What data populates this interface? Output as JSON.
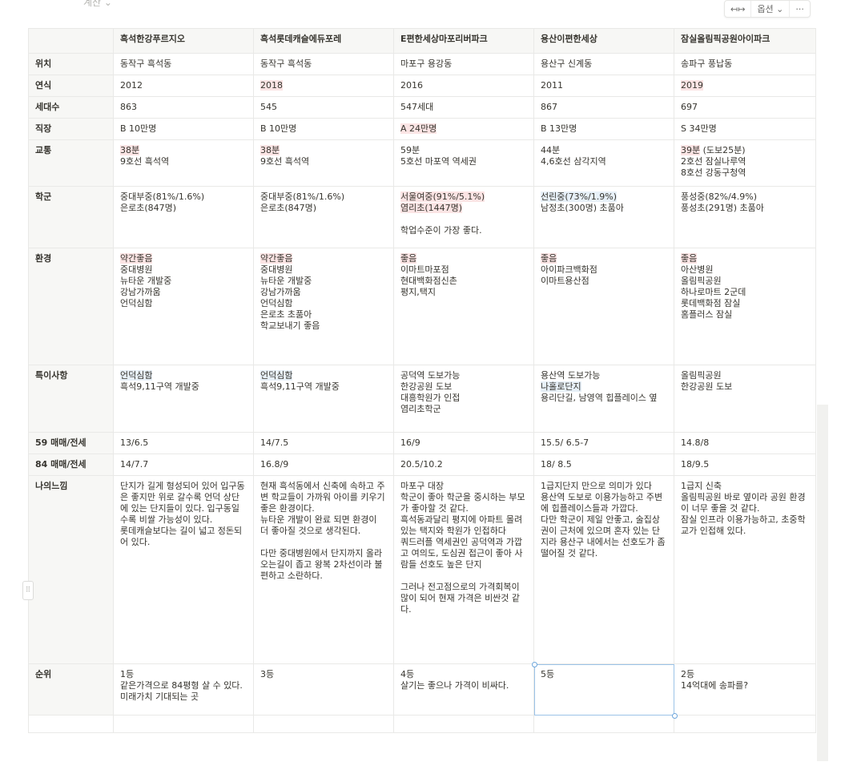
{
  "view_label": "계산 ⌄",
  "toolbar": {
    "resize": "↤↦",
    "options": "옵션 ⌄",
    "more": "···"
  },
  "columns": [
    "흑석한강푸르지오",
    "흑석롯데캐슬에듀포레",
    "E편한세상마포리버파크",
    "용산이편한세상",
    "잠실올림픽공원아이파크"
  ],
  "rows": [
    {
      "label": "위치",
      "cells": [
        [
          {
            "t": "동작구 흑석동"
          }
        ],
        [
          {
            "t": "동작구 흑석동"
          }
        ],
        [
          {
            "t": "마포구 용강동"
          }
        ],
        [
          {
            "t": "용산구 신계동"
          }
        ],
        [
          {
            "t": "송파구 풍납동"
          }
        ]
      ]
    },
    {
      "label": "연식",
      "cells": [
        [
          {
            "t": "2012"
          }
        ],
        [
          {
            "t": "2018",
            "h": "red"
          }
        ],
        [
          {
            "t": "2016"
          }
        ],
        [
          {
            "t": "2011"
          }
        ],
        [
          {
            "t": "2019",
            "h": "red"
          }
        ]
      ]
    },
    {
      "label": "세대수",
      "cells": [
        [
          {
            "t": "863"
          }
        ],
        [
          {
            "t": "545"
          }
        ],
        [
          {
            "t": "547세대"
          }
        ],
        [
          {
            "t": "867"
          }
        ],
        [
          {
            "t": "697"
          }
        ]
      ]
    },
    {
      "label": "직장",
      "cells": [
        [
          {
            "t": "B 10만명"
          }
        ],
        [
          {
            "t": "B 10만명"
          }
        ],
        [
          {
            "t": "A 24만명",
            "h": "red"
          }
        ],
        [
          {
            "t": "B 13만명"
          }
        ],
        [
          {
            "t": "S 34만명"
          }
        ]
      ]
    },
    {
      "label": "교통",
      "cells": [
        [
          {
            "t": "38분",
            "h": "red"
          },
          {
            "t": "9호선 흑석역"
          }
        ],
        [
          {
            "t": "38분",
            "h": "red"
          },
          {
            "t": "9호선 흑석역"
          }
        ],
        [
          {
            "t": "59분"
          },
          {
            "t": "5호선 마포역 역세권"
          }
        ],
        [
          {
            "t": "44분"
          },
          {
            "t": "4,6호선 삼각지역"
          }
        ],
        [
          {
            "t": "39분",
            "h": "red",
            "s": " (도보25분)"
          },
          {
            "t": "2호선 잠실나루역"
          },
          {
            "t": "8호선 강동구청역"
          }
        ]
      ]
    },
    {
      "label": "학군",
      "cells": [
        [
          {
            "t": "중대부중(81%/1.6%)"
          },
          {
            "t": "은로초(847명)"
          }
        ],
        [
          {
            "t": "중대부중(81%/1.6%)"
          },
          {
            "t": "은로초(847명)"
          }
        ],
        [
          {
            "t": "서울여중(91%/5.1%)",
            "h": "red"
          },
          {
            "t": "염리초(1447명)",
            "h": "red"
          },
          {
            "t": " "
          },
          {
            "t": "학업수준이 가장 좋다."
          }
        ],
        [
          {
            "t": "선린중(73%/1.9%)",
            "h": "blue"
          },
          {
            "t": "남정초(300명) 초품아"
          }
        ],
        [
          {
            "t": "풍성중(82%/4.9%)"
          },
          {
            "t": "풍성초(291명) 초품아"
          }
        ]
      ]
    },
    {
      "label": "환경",
      "cells": [
        [
          {
            "t": "약간좋음",
            "h": "red"
          },
          {
            "t": "중대병원"
          },
          {
            "t": "뉴타운 개발중"
          },
          {
            "t": "강남가까움"
          },
          {
            "t": "언덕심함"
          }
        ],
        [
          {
            "t": "약간좋음",
            "h": "red"
          },
          {
            "t": "중대병원"
          },
          {
            "t": "뉴타운 개발중"
          },
          {
            "t": "강남가까움"
          },
          {
            "t": "언덕심함"
          },
          {
            "t": "은로초 초품아"
          },
          {
            "t": "학교보내기 좋음"
          }
        ],
        [
          {
            "t": "좋음",
            "h": "red"
          },
          {
            "t": "이마트마포점"
          },
          {
            "t": "현대백화점신촌"
          },
          {
            "t": "평지,택지"
          }
        ],
        [
          {
            "t": "좋음",
            "h": "red"
          },
          {
            "t": "아이파크백화점"
          },
          {
            "t": "이마트용산점"
          }
        ],
        [
          {
            "t": "좋음",
            "h": "red"
          },
          {
            "t": "아산병원"
          },
          {
            "t": "올림픽공원"
          },
          {
            "t": "하나로마트 2군데"
          },
          {
            "t": "롯데백화점 잠실"
          },
          {
            "t": "홈플러스 잠실"
          }
        ]
      ]
    },
    {
      "label": "특이사항",
      "cells": [
        [
          {
            "t": "언덕심함",
            "h": "blue"
          },
          {
            "t": "흑석9,11구역 개발중"
          }
        ],
        [
          {
            "t": "언덕심함",
            "h": "blue"
          },
          {
            "t": "흑석9,11구역 개발중"
          }
        ],
        [
          {
            "t": "공덕역 도보가능"
          },
          {
            "t": "한강공원 도보"
          },
          {
            "t": "대흥학원가 인접"
          },
          {
            "t": "염리초학군"
          }
        ],
        [
          {
            "t": "용산역 도보가능"
          },
          {
            "t": "나홀로단지",
            "h": "blue"
          },
          {
            "t": "용리단길, 남영역 힙플레이스 옆"
          }
        ],
        [
          {
            "t": "올림픽공원"
          },
          {
            "t": "한강공원 도보"
          }
        ]
      ]
    },
    {
      "label": "59 매매/전세",
      "cells": [
        [
          {
            "t": "13/6.5"
          }
        ],
        [
          {
            "t": "14/7.5"
          }
        ],
        [
          {
            "t": "16/9"
          }
        ],
        [
          {
            "t": "15.5/ 6.5-7"
          }
        ],
        [
          {
            "t": "14.8/8"
          }
        ]
      ]
    },
    {
      "label": "84 매매/전세",
      "cells": [
        [
          {
            "t": "14/7.7"
          }
        ],
        [
          {
            "t": "16.8/9"
          }
        ],
        [
          {
            "t": "20.5/10.2"
          }
        ],
        [
          {
            "t": "18/ 8.5"
          }
        ],
        [
          {
            "t": "18/9.5"
          }
        ]
      ]
    },
    {
      "label": "나의느낌",
      "cells": [
        [
          {
            "t": "단지가 길게 형성되어 있어 입구동은 좋지만 위로 갈수록 언덕 상단에 있는 단지들이 있다. 입구동일 수록 비쌀 가능성이 있다."
          },
          {
            "t": "롯데캐슬보다는 길이 넓고 정돈되어 있다."
          }
        ],
        [
          {
            "t": "현재 흑석동에서 신축에 속하고 주변 학교들이 가까워 아이를 키우기 좋은 환경이다."
          },
          {
            "t": "뉴타운 개발이 완료 되면 환경이 더 좋아질 것으로 생각된다."
          },
          {
            "t": " "
          },
          {
            "t": "다만 중대병원에서 단지까지 올라오는길이 좁고 왕복 2차선이라 불편하고 소란하다."
          }
        ],
        [
          {
            "t": "마포구 대장"
          },
          {
            "t": "학군이 좋아 학군을 중시하는 부모가 좋아할 것 같다."
          },
          {
            "t": "흑석동과달리 평지에 아파트 몰려있는 택지와 학원가 인접하다"
          },
          {
            "t": "쿼드러플 역세권인 공덕역과 가깝고 여의도, 도심권 접근이 좋아 사람들 선호도 높은 단지"
          },
          {
            "t": " "
          },
          {
            "t": "그러나 전고점으로의 가격회복이 많이 되어 현재 가격은 비싼것 같다."
          }
        ],
        [
          {
            "t": "1급지단지 만으로 의미가 있다"
          },
          {
            "t": "용산역 도보로 이용가능하고 주변에 힙플레이스들과 가깝다."
          },
          {
            "t": "다만 학군이 제일 안좋고, 술집상권이 근처에 있으며 혼자 있는 단지라 용산구 내에서는 선호도가 좀 떨어질 것 같다."
          }
        ],
        [
          {
            "t": "1급지 신축"
          },
          {
            "t": "올림픽공원 바로 옆이라 공원 환경이 너무 좋을 것 같다."
          },
          {
            "t": "잠실 인프라 이용가능하고, 초중학교가 인접해 있다."
          }
        ]
      ]
    },
    {
      "label": "순위",
      "cells": [
        [
          {
            "t": "1등"
          },
          {
            "t": "같은가격으로 84평형 살 수 있다. 미래가치 기대되는 곳"
          }
        ],
        [
          {
            "t": "3등"
          }
        ],
        [
          {
            "t": "4등"
          },
          {
            "t": "살기는 좋으나 가격이 비싸다."
          }
        ],
        [
          {
            "t": "5등"
          }
        ],
        [
          {
            "t": "2등"
          },
          {
            "t": "14억대에 송파를?"
          }
        ]
      ]
    }
  ]
}
